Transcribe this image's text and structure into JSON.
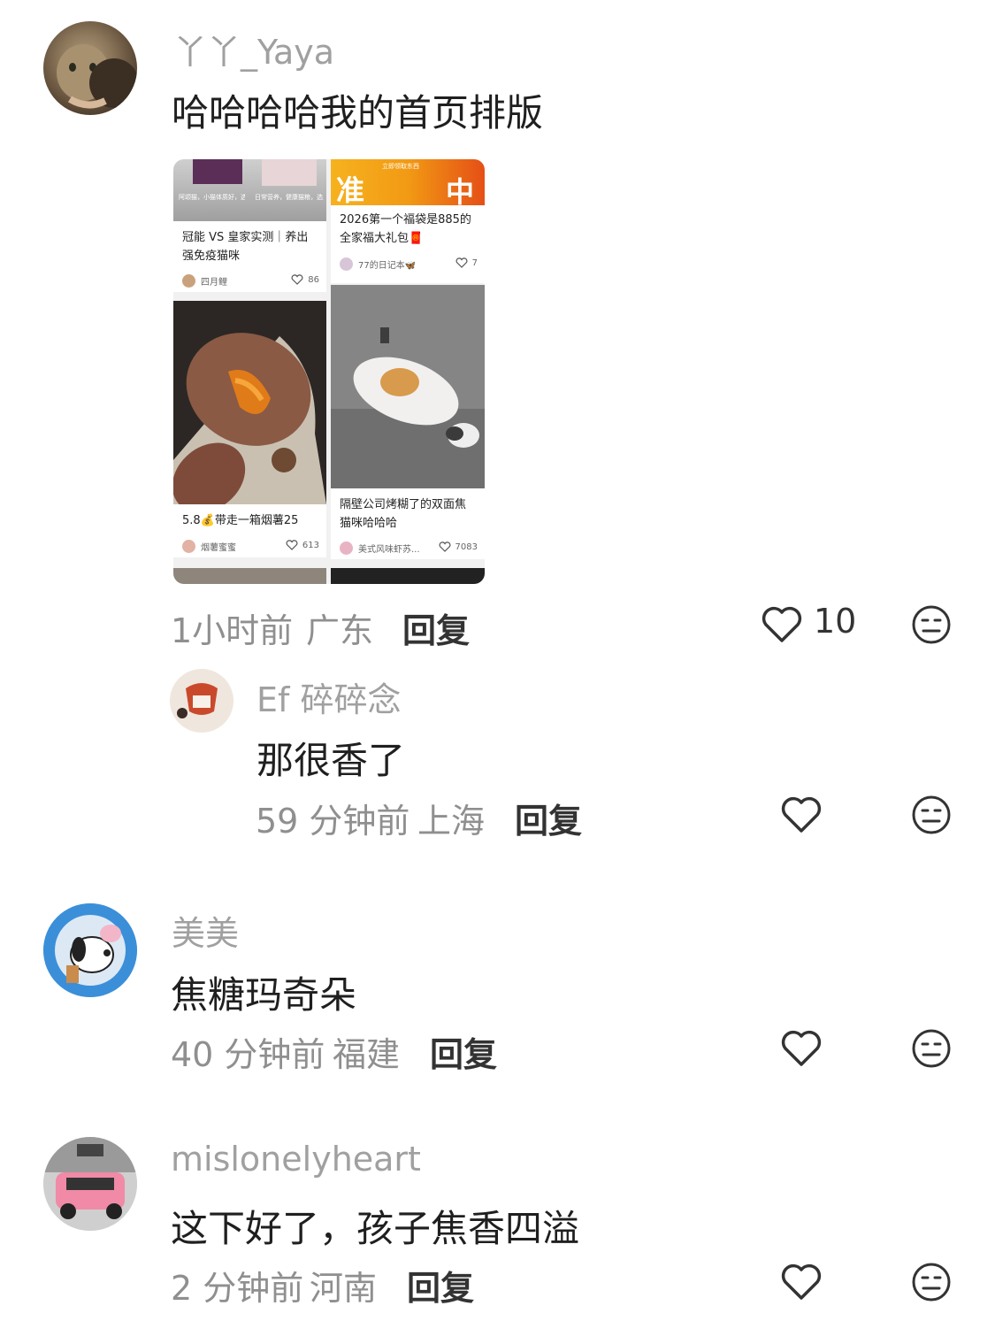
{
  "comments": [
    {
      "user": "丫丫_Yaya",
      "text": "哈哈哈哈我的首页排版",
      "time": "1小时前",
      "location": "广东",
      "reply": "回复",
      "likes": "10"
    },
    {
      "user": "Ef 碎碎念",
      "text": "那很香了",
      "time": "59 分钟前",
      "location": "上海",
      "reply": "回复"
    },
    {
      "user": "美美",
      "text": "焦糖玛奇朵",
      "time": "40 分钟前",
      "location": "福建",
      "reply": "回复"
    },
    {
      "user": "mislonelyheart",
      "text": "这下好了，孩子焦香四溢",
      "time": "2 分钟前",
      "location": "河南",
      "reply": "回复"
    }
  ],
  "embedded_feed": {
    "cards": [
      {
        "banner_left": "阿颂猫，小猫体质好，选冠能",
        "banner_right": "日常营养，健康猫粮，选皇家",
        "title": "冠能 VS 皇家实测｜养出强免疫猫咪",
        "author": "四月鲤",
        "likes": "86"
      },
      {
        "banner": "立即领取东西",
        "big_left": "准",
        "big_right": "中",
        "title": "2026第一个福袋是885的全家福大礼包🧧",
        "author": "77的日记本🦋",
        "likes": "7"
      },
      {
        "title": "5.8💰带走一箱烟薯25",
        "author": "烟薯蜜蜜",
        "likes": "613"
      },
      {
        "title": "隔壁公司烤糊了的双面焦猫咪哈哈哈",
        "author": "美式风味虾苏...",
        "likes": "7083"
      }
    ]
  }
}
